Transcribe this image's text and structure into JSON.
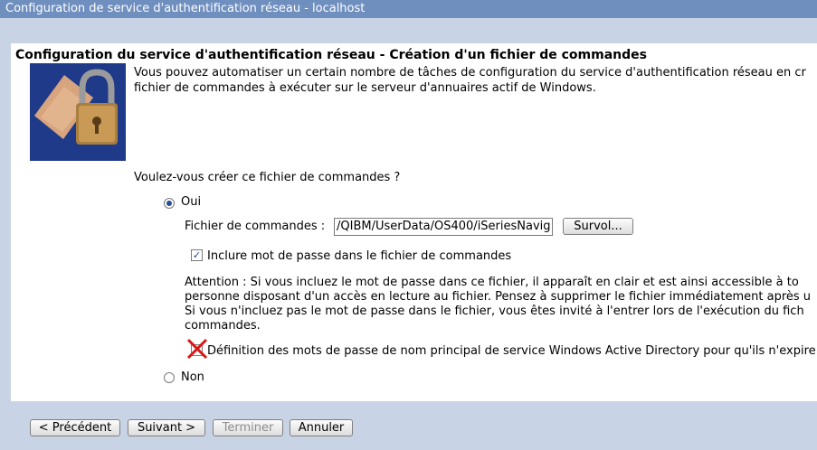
{
  "window": {
    "title": "Configuration de service d'authentification réseau - localhost"
  },
  "page": {
    "heading": "Configuration du service d'authentification réseau - Création d'un fichier de commandes",
    "intro_line1": "Vous pouvez automatiser un certain nombre de tâches de configuration du service d'authentification réseau en cr",
    "intro_line2": "fichier de commandes à exécuter sur le serveur d'annuaires actif de Windows.",
    "question": "Voulez-vous créer ce fichier de commandes ?",
    "option_yes": "Oui",
    "command_file_label": "Fichier de commandes :",
    "command_file_value": "/QIBM/UserData/OS400/iSeriesNavig",
    "browse_button": "Survol...",
    "include_password_label": "Inclure mot de passe dans le fichier de commandes",
    "include_password_checked": true,
    "warning_lines": [
      "Attention : Si vous incluez le mot de passe dans ce fichier, il apparaît en clair et est ainsi accessible à to",
      "personne disposant d'un accès en lecture au fichier. Pensez à supprimer le fichier immédiatement après u",
      "Si vous n'incluez pas le mot de passe dans le fichier, vous êtes invité à l'entrer lors de l'exécution du fich",
      "commandes."
    ],
    "spn_password_label": "Définition des mots de passe de nom principal de service Windows Active Directory pour qu'ils n'expire",
    "option_no": "Non"
  },
  "footer": {
    "back_button": "< Précédent",
    "next_button": "Suivant >",
    "finish_button": "Terminer",
    "cancel_button": "Annuler"
  },
  "colors": {
    "titlebar": "#6f8fbf",
    "background": "#c8d4e6",
    "x_mark": "#d81818"
  },
  "icons": {
    "wizard_image": "padlock-icon",
    "disabled_checkbox_overlay": "red-x-icon"
  }
}
